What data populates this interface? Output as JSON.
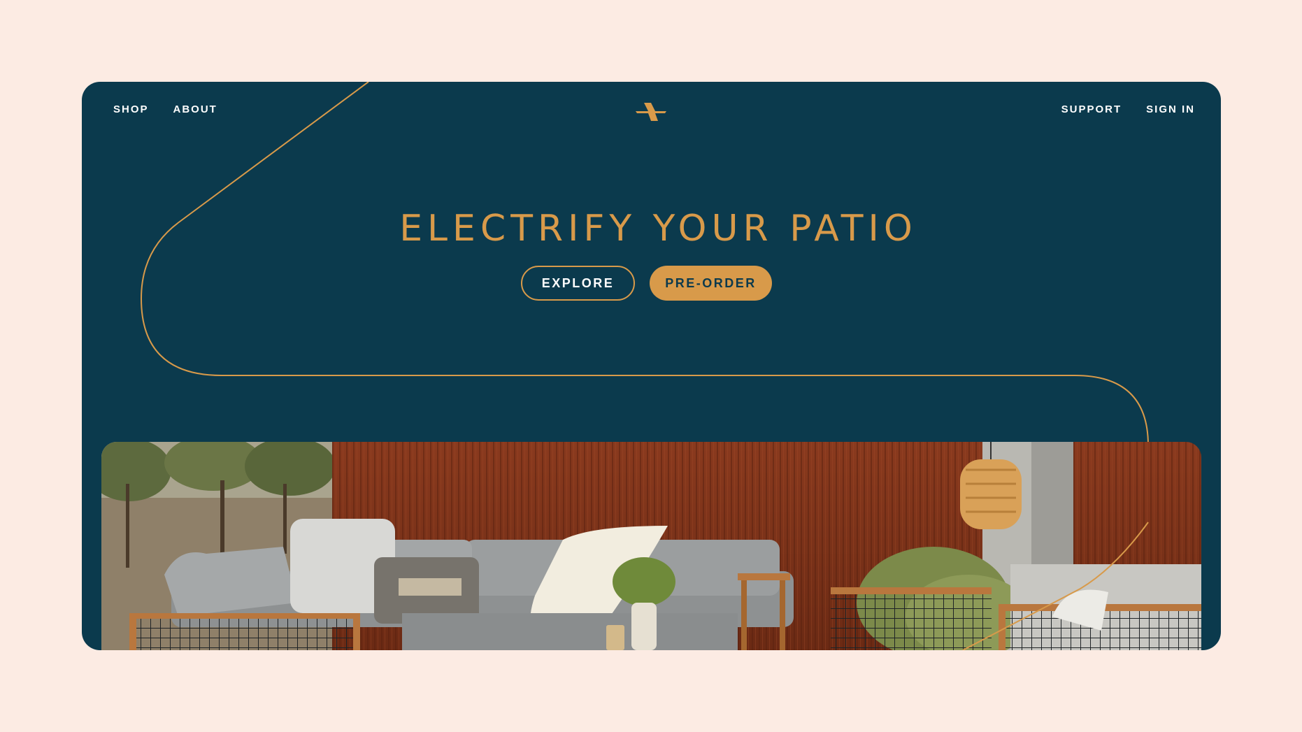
{
  "nav": {
    "left": [
      {
        "label": "SHOP"
      },
      {
        "label": "ABOUT"
      }
    ],
    "right": [
      {
        "label": "SUPPORT"
      },
      {
        "label": "SIGN IN"
      }
    ]
  },
  "logo": {
    "icon": "lightning-bolt-logo-icon"
  },
  "hero": {
    "title": "ELECTRIFY YOUR PATIO",
    "explore_label": "EXPLORE",
    "preorder_label": "PRE-ORDER"
  },
  "image": {
    "icon": "patio-furniture-photo"
  },
  "colors": {
    "page_background": "#fcebe3",
    "card_background": "#0b3a4d",
    "accent": "#d89a4a",
    "nav_text": "#ffffff"
  }
}
